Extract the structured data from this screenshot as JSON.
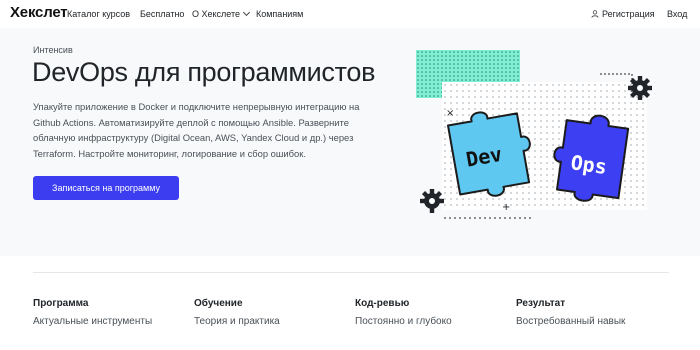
{
  "brand": {
    "name": "Хекслет"
  },
  "nav": {
    "catalog": "Каталог курсов",
    "free": "Бесплатно",
    "about": "О Хекслете",
    "companies": "Компаниям",
    "register": "Регистрация",
    "login": "Вход"
  },
  "hero": {
    "kicker": "Интенсив",
    "title": "DevOps для программистов",
    "description": "Упакуйте приложение в Docker и подключите непрерывную интеграцию на Github Actions. Автоматизируйте деплой с помощью Ansible. Разверните облачную инфраструктуру (Digital Ocean, AWS, Yandex Cloud и др.) через Terraform. Настройте мониторинг, логирование и сбор ошибок.",
    "cta": "Записаться на программу"
  },
  "illustration": {
    "left_piece": "Dev",
    "right_piece": "Ops",
    "colors": {
      "teal": "#5ec8f0",
      "purple": "#3d3ff2",
      "mint": "#7ff0d2"
    }
  },
  "features": [
    {
      "title": "Программа",
      "subtitle": "Актуальные инструменты"
    },
    {
      "title": "Обучение",
      "subtitle": "Теория и практика"
    },
    {
      "title": "Код-ревью",
      "subtitle": "Постоянно и глубоко"
    },
    {
      "title": "Результат",
      "subtitle": "Востребованный навык"
    }
  ],
  "colors": {
    "accent": "#3c3cf0",
    "hero_bg": "#f8f9fa"
  }
}
